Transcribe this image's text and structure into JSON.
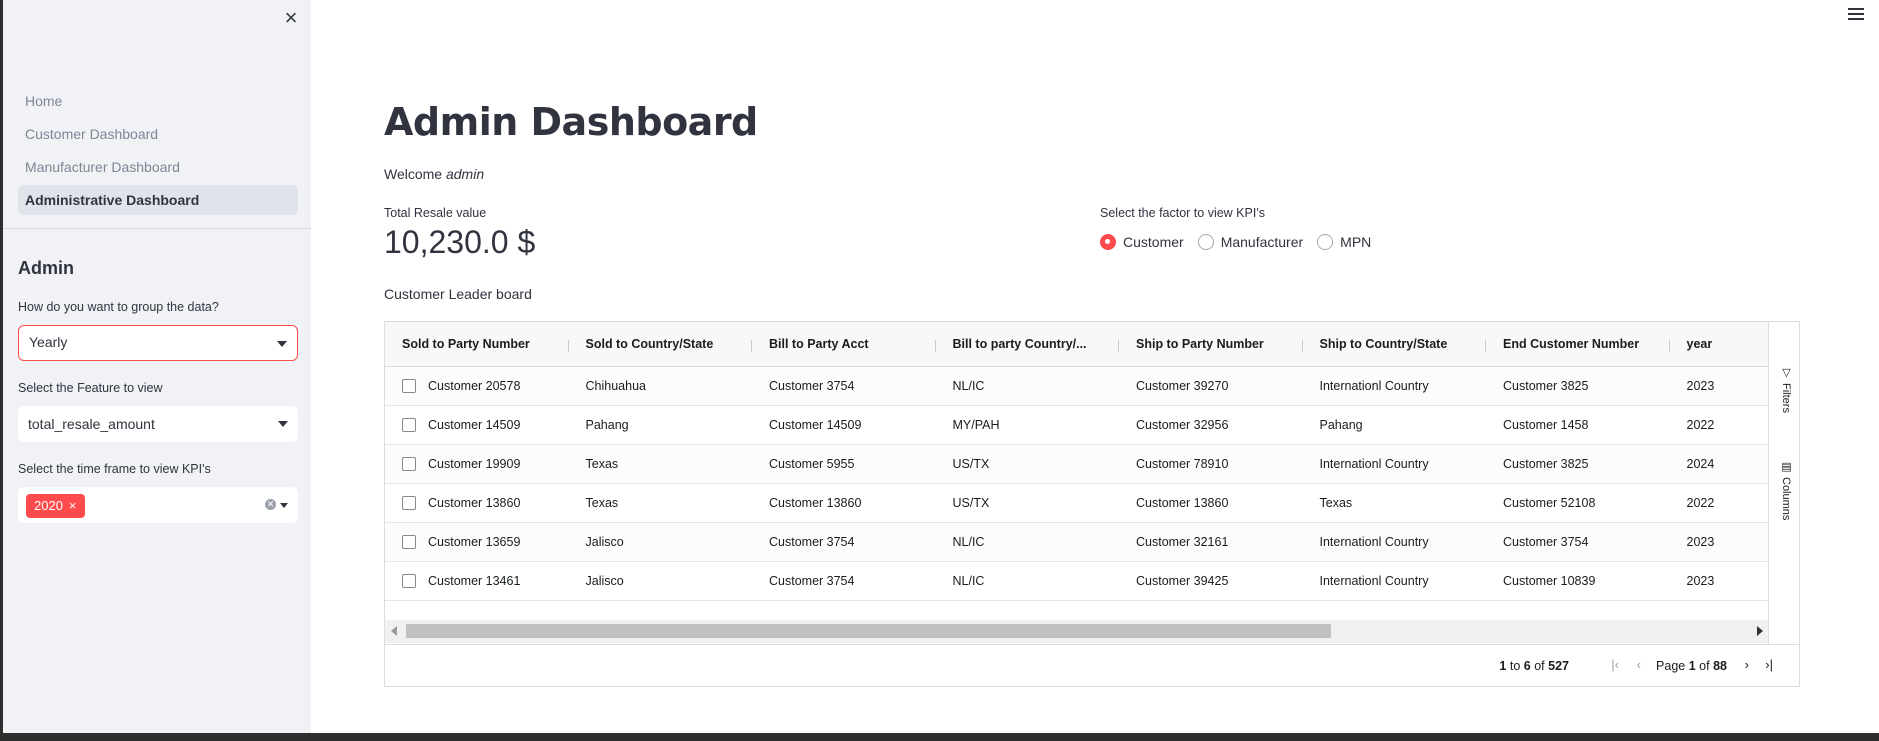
{
  "sidebar": {
    "close_icon": "×",
    "nav": [
      "Home",
      "Customer Dashboard",
      "Manufacturer Dashboard",
      "Administrative Dashboard"
    ],
    "active_nav": 3,
    "title": "Admin",
    "group_label": "How do you want to group the data?",
    "group_value": "Yearly",
    "feature_label": "Select the Feature to view",
    "feature_value": "total_resale_amount",
    "timeframe_label": "Select the time frame to view KPI's",
    "timeframe_tags": [
      "2020"
    ],
    "tag_remove": "×"
  },
  "main": {
    "title": "Admin Dashboard",
    "welcome_prefix": "Welcome",
    "welcome_user": "admin",
    "metric_label": "Total Resale value",
    "metric_value": "10,230.0 $",
    "radio_label": "Select the factor to view KPI's",
    "radio_options": [
      "Customer",
      "Manufacturer",
      "MPN"
    ],
    "radio_selected": "Customer",
    "board_label": "Customer Leader board"
  },
  "grid": {
    "columns": [
      "Sold to Party Number",
      "Sold to Country/State",
      "Bill to Party Acct",
      "Bill to party Country/...",
      "Ship to Party Number",
      "Ship to Country/State",
      "End Customer Number",
      "year"
    ],
    "rows": [
      [
        "Customer 20578",
        "Chihuahua",
        "Customer 3754",
        "NL/IC",
        "Customer 39270",
        "Internationl Country",
        "Customer 3825",
        "2023"
      ],
      [
        "Customer 14509",
        "Pahang",
        "Customer 14509",
        "MY/PAH",
        "Customer 32956",
        "Pahang",
        "Customer 1458",
        "2022"
      ],
      [
        "Customer 19909",
        "Texas",
        "Customer 5955",
        "US/TX",
        "Customer 78910",
        "Internationl Country",
        "Customer 3825",
        "2024"
      ],
      [
        "Customer 13860",
        "Texas",
        "Customer 13860",
        "US/TX",
        "Customer 13860",
        "Texas",
        "Customer 52108",
        "2022"
      ],
      [
        "Customer 13659",
        "Jalisco",
        "Customer 3754",
        "NL/IC",
        "Customer 32161",
        "Internationl Country",
        "Customer 3754",
        "2023"
      ],
      [
        "Customer 13461",
        "Jalisco",
        "Customer 3754",
        "NL/IC",
        "Customer 39425",
        "Internationl Country",
        "Customer 10839",
        "2023"
      ]
    ],
    "side_filters": "Filters",
    "side_columns": "Columns",
    "pager": {
      "from": "1",
      "to_word": "to",
      "to": "6",
      "of_word": "of",
      "total": "527",
      "page_word": "Page",
      "page": "1",
      "page_of": "of",
      "pages": "88"
    }
  }
}
